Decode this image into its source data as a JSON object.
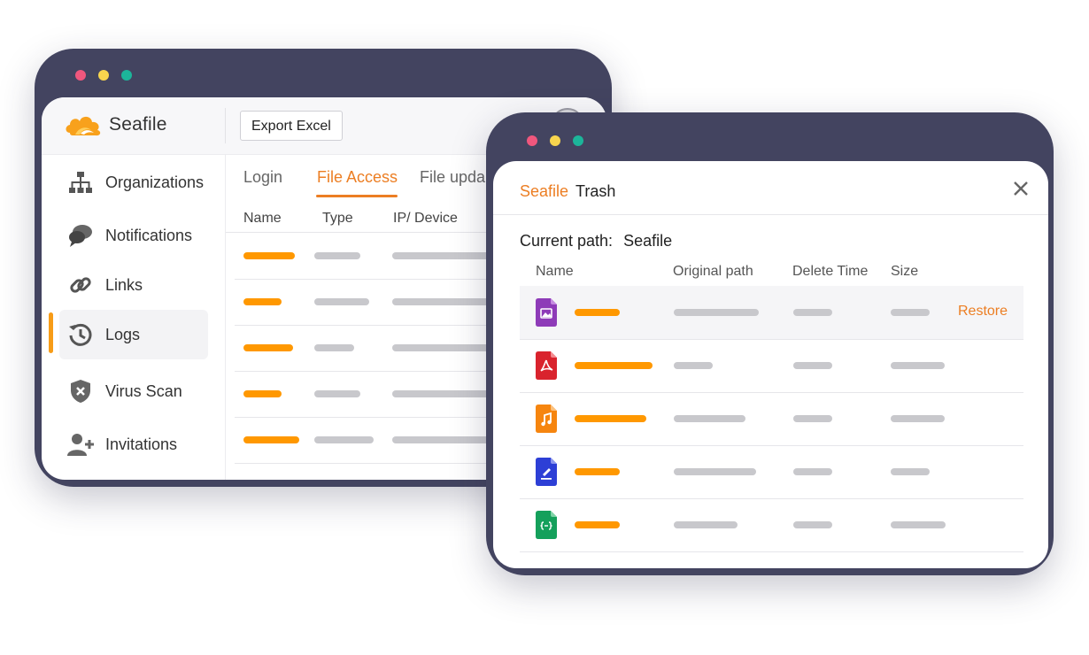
{
  "colors": {
    "accent": "#ec7e23",
    "orange_bar": "#ff9800",
    "gray_bar": "#c8c8cc",
    "window_frame": "#434460",
    "dot_red": "#f0577d",
    "dot_yellow": "#f8d54e",
    "dot_green": "#1cb59a"
  },
  "admin_window": {
    "brand": "Seafile",
    "export_label": "Export Excel",
    "sidebar": [
      {
        "label": "Organizations",
        "icon": "org-chart-icon"
      },
      {
        "label": "Notifications",
        "icon": "chat-bubbles-icon"
      },
      {
        "label": "Links",
        "icon": "link-icon"
      },
      {
        "label": "Logs",
        "icon": "history-icon",
        "active": true
      },
      {
        "label": "Virus Scan",
        "icon": "shield-x-icon"
      },
      {
        "label": "Invitations",
        "icon": "user-plus-icon"
      }
    ],
    "tabs": [
      {
        "label": "Login"
      },
      {
        "label": "File Access",
        "active": true
      },
      {
        "label": "File upda"
      }
    ],
    "columns": [
      "Name",
      "Type",
      "IP/ Device"
    ]
  },
  "trash_dialog": {
    "brand": "Seafile",
    "title": "Trash",
    "current_path_label": "Current path:",
    "current_path_value": "Seafile",
    "columns": [
      "Name",
      "Original path",
      "Delete Time",
      "Size"
    ],
    "rows": [
      {
        "icon": "image-file-icon",
        "restore": "Restore"
      },
      {
        "icon": "pdf-file-icon"
      },
      {
        "icon": "music-file-icon"
      },
      {
        "icon": "document-file-icon"
      },
      {
        "icon": "code-file-icon"
      }
    ]
  }
}
